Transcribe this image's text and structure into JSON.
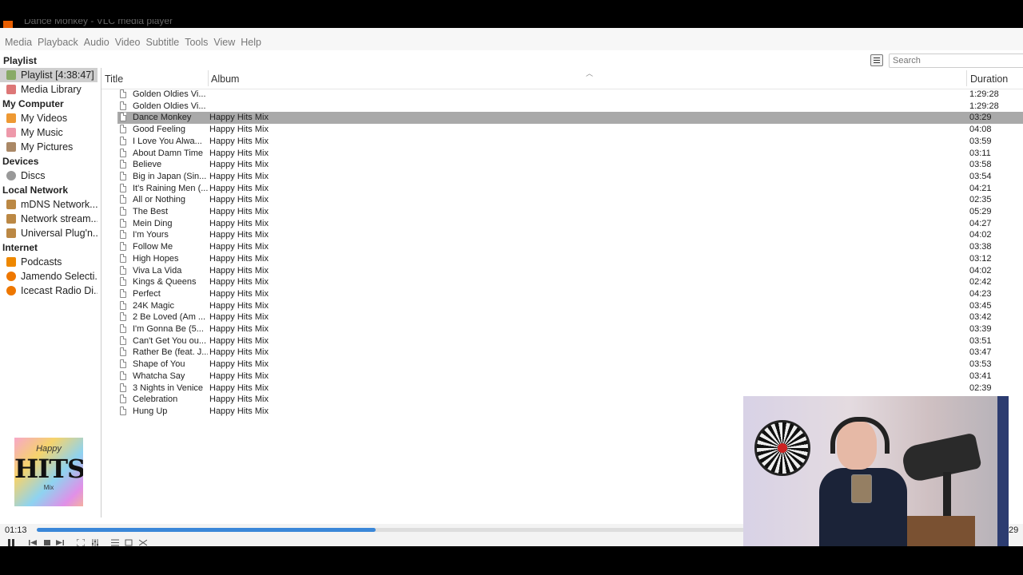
{
  "window": {
    "title": "Dance Monkey - VLC media player"
  },
  "menubar": [
    "Media",
    "Playback",
    "Audio",
    "Video",
    "Subtitle",
    "Tools",
    "View",
    "Help"
  ],
  "playlist_label": "Playlist",
  "search": {
    "placeholder": "Search"
  },
  "sidebar": {
    "items": [
      {
        "label": "Playlist [4:38:47]",
        "icon": "playlist-icon",
        "selected": true
      },
      {
        "label": "Media Library",
        "icon": "library-icon"
      }
    ],
    "my_computer": {
      "heading": "My Computer",
      "items": [
        {
          "label": "My Videos",
          "icon": "videos-icon"
        },
        {
          "label": "My Music",
          "icon": "music-icon"
        },
        {
          "label": "My Pictures",
          "icon": "pictures-icon"
        }
      ]
    },
    "devices": {
      "heading": "Devices",
      "items": [
        {
          "label": "Discs",
          "icon": "disc-icon"
        }
      ]
    },
    "local_network": {
      "heading": "Local Network",
      "items": [
        {
          "label": "mDNS Network...",
          "icon": "network-icon"
        },
        {
          "label": "Network stream...",
          "icon": "network-icon"
        },
        {
          "label": "Universal Plug'n...",
          "icon": "network-icon"
        }
      ]
    },
    "internet": {
      "heading": "Internet",
      "items": [
        {
          "label": "Podcasts",
          "icon": "podcast-icon"
        },
        {
          "label": "Jamendo Selecti...",
          "icon": "radio-icon"
        },
        {
          "label": "Icecast Radio Di...",
          "icon": "radio-icon"
        }
      ]
    },
    "album_art": {
      "line1": "Happy",
      "line2": "HITS",
      "line3": "Mix"
    }
  },
  "columns": {
    "title": "Title",
    "album": "Album",
    "duration": "Duration"
  },
  "tracks": [
    {
      "title": "Golden Oldies Vi...",
      "album": "",
      "duration": "1:29:28"
    },
    {
      "title": "Golden Oldies Vi...",
      "album": "",
      "duration": "1:29:28"
    },
    {
      "title": "Dance Monkey",
      "album": "Happy Hits Mix",
      "duration": "03:29",
      "selected": true
    },
    {
      "title": "Good Feeling",
      "album": "Happy Hits Mix",
      "duration": "04:08"
    },
    {
      "title": "I Love You Alwa...",
      "album": "Happy Hits Mix",
      "duration": "03:59"
    },
    {
      "title": "About Damn Time",
      "album": "Happy Hits Mix",
      "duration": "03:11"
    },
    {
      "title": "Believe",
      "album": "Happy Hits Mix",
      "duration": "03:58"
    },
    {
      "title": "Big in Japan (Sin...",
      "album": "Happy Hits Mix",
      "duration": "03:54"
    },
    {
      "title": "It's Raining Men (...",
      "album": "Happy Hits Mix",
      "duration": "04:21"
    },
    {
      "title": "All or Nothing",
      "album": "Happy Hits Mix",
      "duration": "02:35"
    },
    {
      "title": "The Best",
      "album": "Happy Hits Mix",
      "duration": "05:29"
    },
    {
      "title": "Mein Ding",
      "album": "Happy Hits Mix",
      "duration": "04:27"
    },
    {
      "title": "I'm Yours",
      "album": "Happy Hits Mix",
      "duration": "04:02"
    },
    {
      "title": "Follow Me",
      "album": "Happy Hits Mix",
      "duration": "03:38"
    },
    {
      "title": "High Hopes",
      "album": "Happy Hits Mix",
      "duration": "03:12"
    },
    {
      "title": "Viva La Vida",
      "album": "Happy Hits Mix",
      "duration": "04:02"
    },
    {
      "title": "Kings & Queens",
      "album": "Happy Hits Mix",
      "duration": "02:42"
    },
    {
      "title": "Perfect",
      "album": "Happy Hits Mix",
      "duration": "04:23"
    },
    {
      "title": "24K Magic",
      "album": "Happy Hits Mix",
      "duration": "03:45"
    },
    {
      "title": "2 Be Loved (Am ...",
      "album": "Happy Hits Mix",
      "duration": "03:42"
    },
    {
      "title": "I'm Gonna Be (5...",
      "album": "Happy Hits Mix",
      "duration": "03:39"
    },
    {
      "title": "Can't Get You ou...",
      "album": "Happy Hits Mix",
      "duration": "03:51"
    },
    {
      "title": "Rather Be (feat. J...",
      "album": "Happy Hits Mix",
      "duration": "03:47"
    },
    {
      "title": "Shape of You",
      "album": "Happy Hits Mix",
      "duration": "03:53"
    },
    {
      "title": "Whatcha Say",
      "album": "Happy Hits Mix",
      "duration": "03:41"
    },
    {
      "title": "3 Nights in Venice",
      "album": "Happy Hits Mix",
      "duration": "02:39"
    },
    {
      "title": "Celebration",
      "album": "Happy Hits Mix",
      "duration": ""
    },
    {
      "title": "Hung Up",
      "album": "Happy Hits Mix",
      "duration": ""
    }
  ],
  "player": {
    "elapsed": "01:13",
    "remaining": "29",
    "progress_fraction": 0.35
  },
  "colors": {
    "accent": "#3a87d8",
    "selection": "#a9a9a9"
  }
}
